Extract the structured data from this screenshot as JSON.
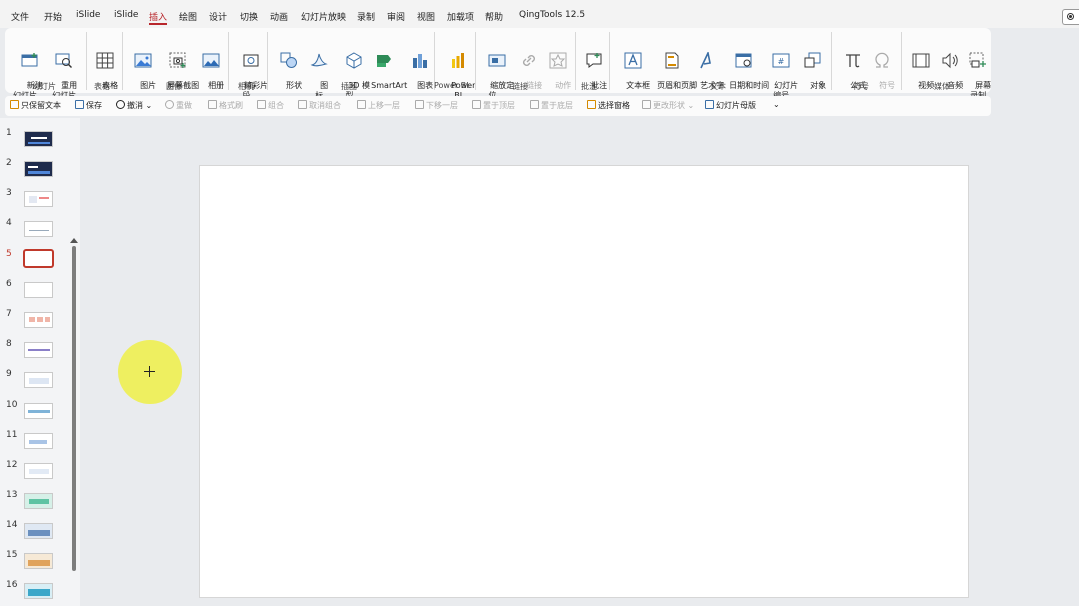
{
  "menu": [
    "文件",
    "开始",
    "iSlide",
    "iSlide",
    "插入",
    "绘图",
    "设计",
    "切换",
    "动画",
    "幻灯片放映",
    "录制",
    "审阅",
    "视图",
    "加载项",
    "帮助",
    "QingTools 12.5"
  ],
  "active_menu": "插入",
  "ribbon": {
    "buttons": [
      "新建\n幻灯片 ⌄",
      "重用\n幻灯片",
      "表格\n⌄",
      "图片\n⌄",
      "屏幕截图\n⌄",
      "相册\n⌄",
      "精彩片\n段 ⌄",
      "形状\n⌄",
      "图\n标",
      "3D 模\n型 ⌄",
      "SmartArt",
      "图表",
      "Power\nBI",
      "缩放定\n位 ⌄",
      "链接\n⌄",
      "动作",
      "批注",
      "文本框\n⌄",
      "页眉和页脚",
      "艺术字\n⌄",
      "日期和时间",
      "幻灯片\n编号",
      "对象",
      "公式\n⌄",
      "符号",
      "视频\n⌄",
      "音频\n⌄",
      "屏幕\n录制"
    ],
    "groups": [
      "幻灯片",
      "表格",
      "图像",
      "相机",
      "插图",
      "Power BI",
      "链接",
      "批注",
      "文本",
      "符号",
      "媒体"
    ]
  },
  "qat": [
    "只保留文本",
    "保存",
    "撤消 ⌄",
    "重做",
    "格式刷",
    "组合",
    "取消组合",
    "上移一层",
    "下移一层",
    "置于顶层",
    "置于底层",
    "选择窗格",
    "更改形状 ⌄",
    "幻灯片母版",
    "⌄"
  ],
  "slides": [
    "1",
    "2",
    "3",
    "4",
    "5",
    "6",
    "7",
    "8",
    "9",
    "10",
    "11",
    "12",
    "13",
    "14",
    "15",
    "16"
  ],
  "selected_slide": "5",
  "colors": {
    "accent": "#b8262b",
    "cursor_highlight": "#eef046"
  }
}
